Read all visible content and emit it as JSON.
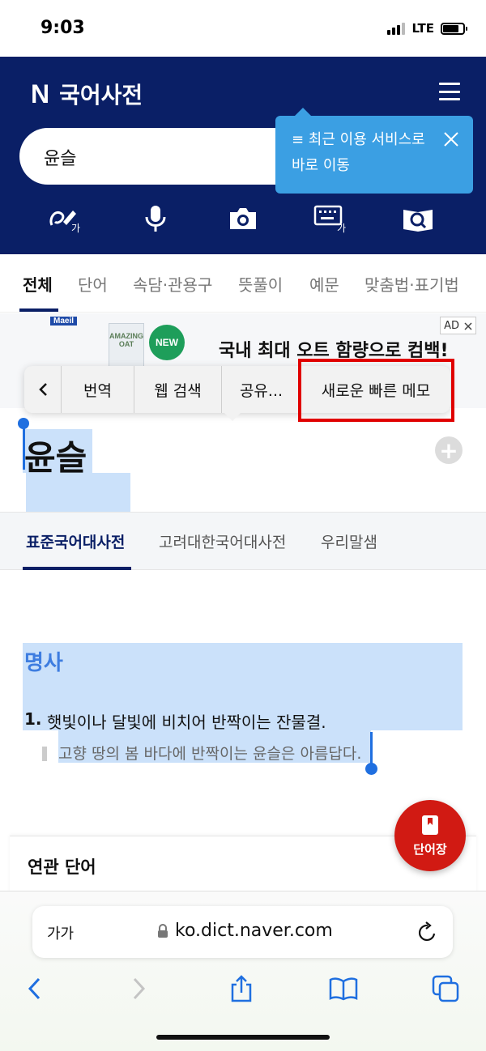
{
  "status_bar": {
    "time": "9:03",
    "network": "LTE"
  },
  "header": {
    "logo": "N",
    "title": "국어사전",
    "search_value": "윤슬",
    "tooltip": {
      "line1": "≡ 최근 이용 서비스로",
      "line2": "바로 이동"
    },
    "tools": [
      "handwriting-icon",
      "microphone-icon",
      "camera-icon",
      "keyboard-icon",
      "book-search-icon"
    ]
  },
  "search_tabs": [
    "전체",
    "단어",
    "속담·관용구",
    "뜻풀이",
    "예문",
    "맞춤법·표기법"
  ],
  "ad": {
    "brand": "Maeil",
    "product": "AMAZING OAT",
    "new_badge": "NEW",
    "text": "국내 최대 오트 함량으로 컴백!",
    "badge": "AD"
  },
  "context_menu": {
    "back": "<",
    "items": [
      "번역",
      "웹 검색",
      "공유...",
      "새로운 빠른 메모"
    ]
  },
  "entry": {
    "word": "윤슬",
    "dict_tabs": [
      "표준국어대사전",
      "고려대한국어대사전",
      "우리말샘"
    ],
    "part_of_speech": "명사",
    "definition_number": "1.",
    "definition": "햇빛이나 달빛에 비치어 반짝이는 잔물결.",
    "example": "고향 땅의 봄 바다에 반짝이는 윤슬은 아름답다."
  },
  "related": {
    "title": "연관 단어"
  },
  "wordbook": {
    "label": "단어장"
  },
  "browser": {
    "text_size": "가가",
    "url": "ko.dict.naver.com"
  },
  "colors": {
    "header_bg": "#0a1f66",
    "tooltip": "#3b9fe3",
    "selection": "#a0c8f5",
    "accent": "#d11a13",
    "highlight_box": "#e00000"
  }
}
